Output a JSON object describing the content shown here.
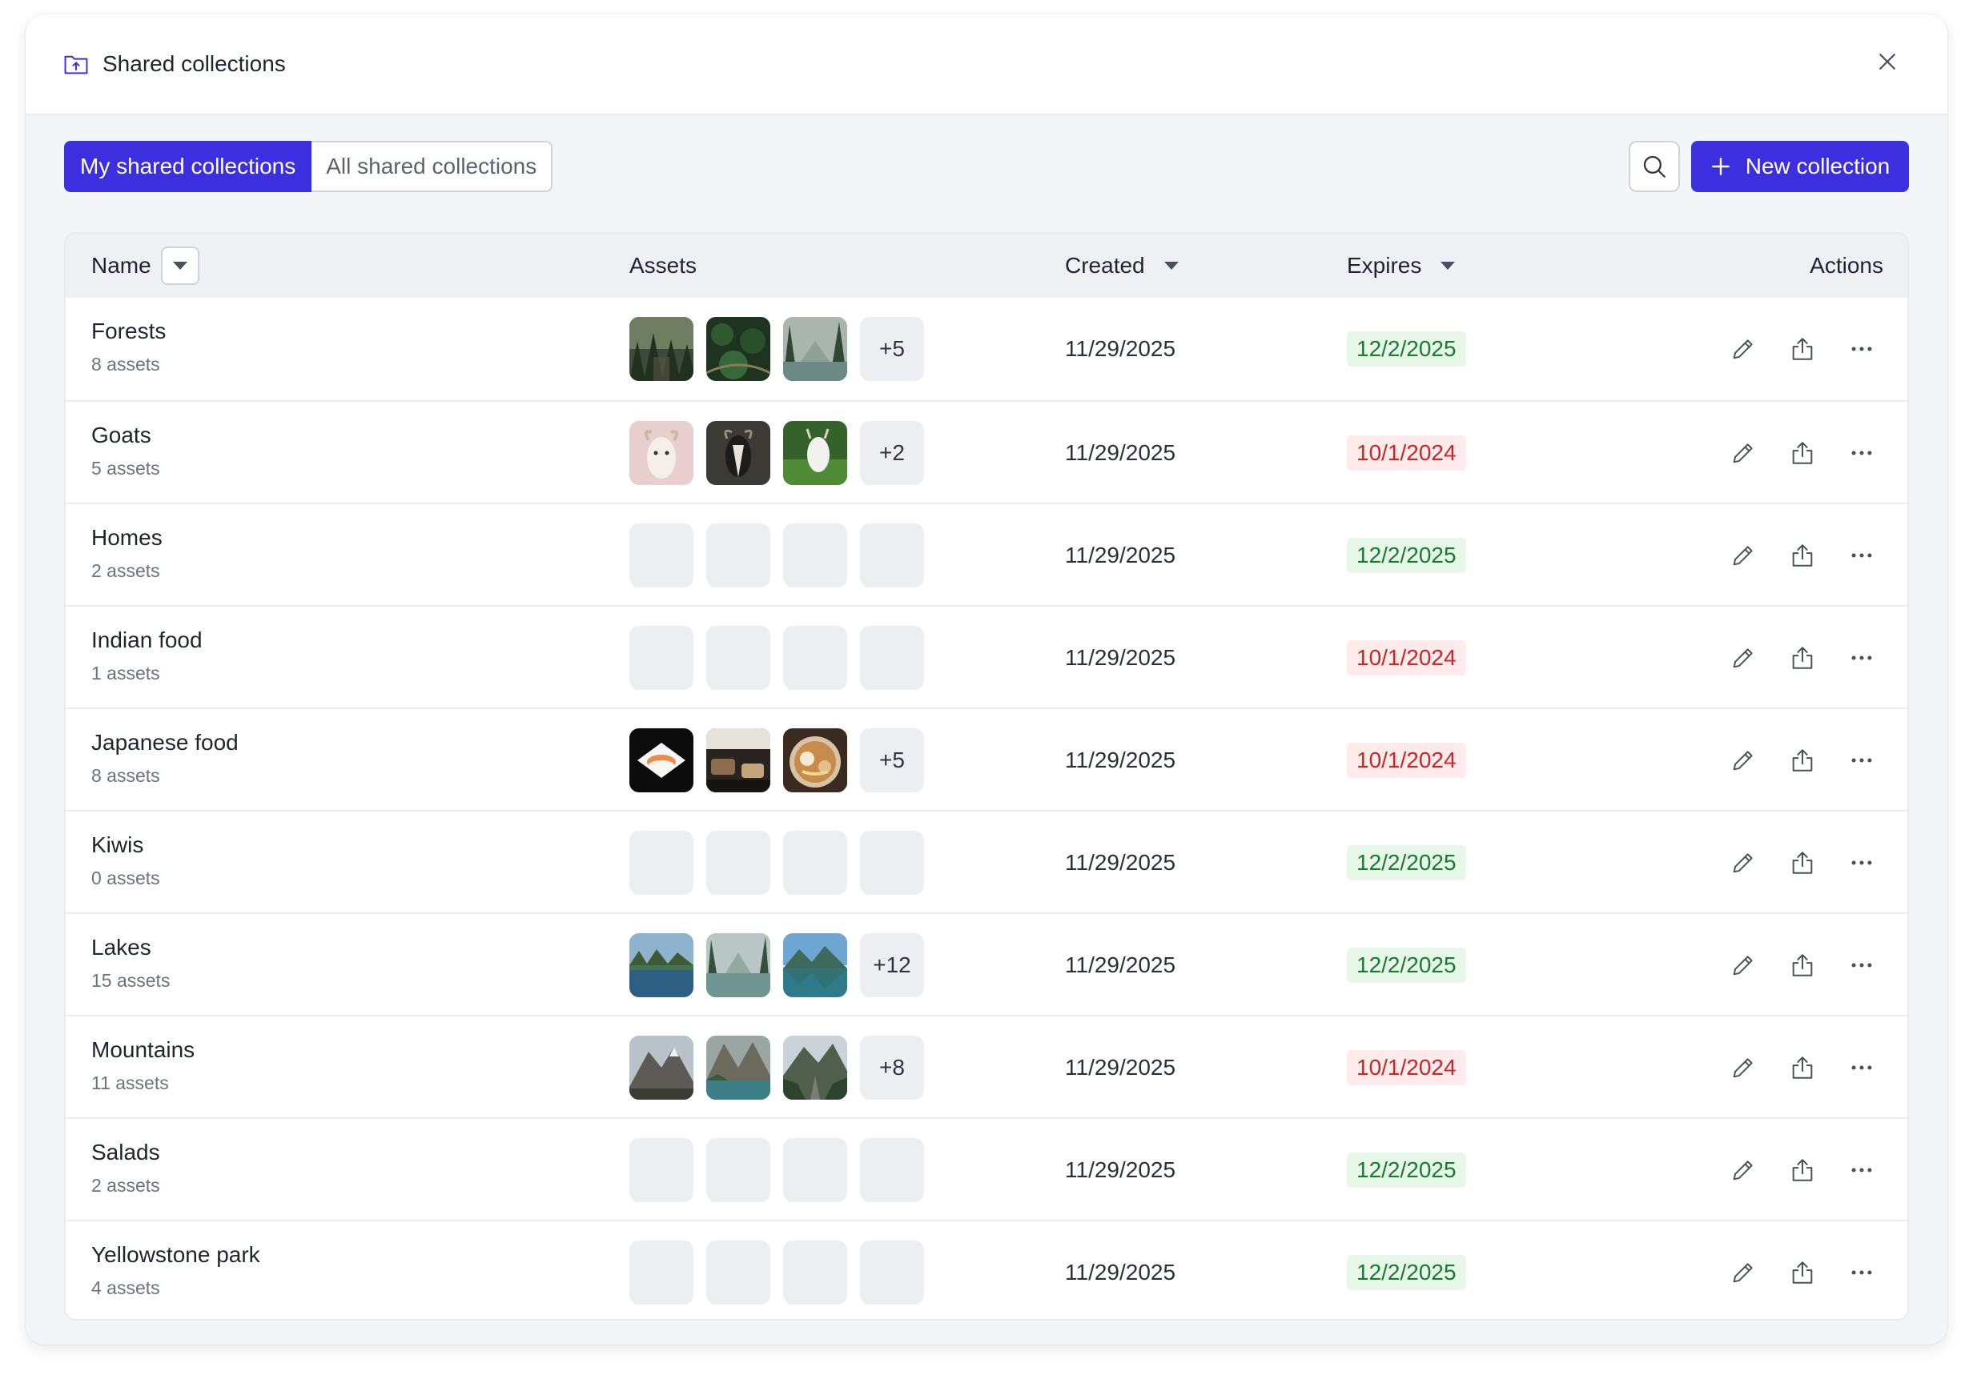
{
  "header": {
    "title": "Shared collections"
  },
  "tabs": [
    {
      "label": "My shared collections",
      "active": true
    },
    {
      "label": "All shared collections",
      "active": false
    }
  ],
  "toolbar": {
    "new_label": "New collection"
  },
  "columns": {
    "name": "Name",
    "assets": "Assets",
    "created": "Created",
    "expires": "Expires",
    "actions": "Actions"
  },
  "colors": {
    "accent": "#3b2fe0",
    "ok": "#1c7a2e",
    "expired": "#c62828"
  },
  "rows": [
    {
      "name": "Forests",
      "count": "8 assets",
      "thumbs": [
        "forest-photo",
        "forest-photo",
        "forest-photo"
      ],
      "more": "+5",
      "created": "11/29/2025",
      "expires": "12/2/2025",
      "status": "ok"
    },
    {
      "name": "Goats",
      "count": "5 assets",
      "thumbs": [
        "goat-photo",
        "goat-photo",
        "goat-photo"
      ],
      "more": "+2",
      "created": "11/29/2025",
      "expires": "10/1/2024",
      "status": "late"
    },
    {
      "name": "Homes",
      "count": "2 assets",
      "thumbs": [],
      "more": "",
      "created": "11/29/2025",
      "expires": "12/2/2025",
      "status": "ok"
    },
    {
      "name": "Indian food",
      "count": "1 assets",
      "thumbs": [],
      "more": "",
      "created": "11/29/2025",
      "expires": "10/1/2024",
      "status": "late"
    },
    {
      "name": "Japanese food",
      "count": "8 assets",
      "thumbs": [
        "sushi-photo",
        "restaurant-photo",
        "ramen-photo"
      ],
      "more": "+5",
      "created": "11/29/2025",
      "expires": "10/1/2024",
      "status": "late"
    },
    {
      "name": "Kiwis",
      "count": "0 assets",
      "thumbs": [],
      "more": "",
      "created": "11/29/2025",
      "expires": "12/2/2025",
      "status": "ok"
    },
    {
      "name": "Lakes",
      "count": "15 assets",
      "thumbs": [
        "lake-photo",
        "lake-photo",
        "lake-photo"
      ],
      "more": "+12",
      "created": "11/29/2025",
      "expires": "12/2/2025",
      "status": "ok"
    },
    {
      "name": "Mountains",
      "count": "11 assets",
      "thumbs": [
        "mountain-photo",
        "mountain-photo",
        "mountain-photo"
      ],
      "more": "+8",
      "created": "11/29/2025",
      "expires": "10/1/2024",
      "status": "late"
    },
    {
      "name": "Salads",
      "count": "2 assets",
      "thumbs": [],
      "more": "",
      "created": "11/29/2025",
      "expires": "12/2/2025",
      "status": "ok"
    },
    {
      "name": "Yellowstone park",
      "count": "4 assets",
      "thumbs": [],
      "more": "",
      "created": "11/29/2025",
      "expires": "12/2/2025",
      "status": "ok"
    }
  ]
}
